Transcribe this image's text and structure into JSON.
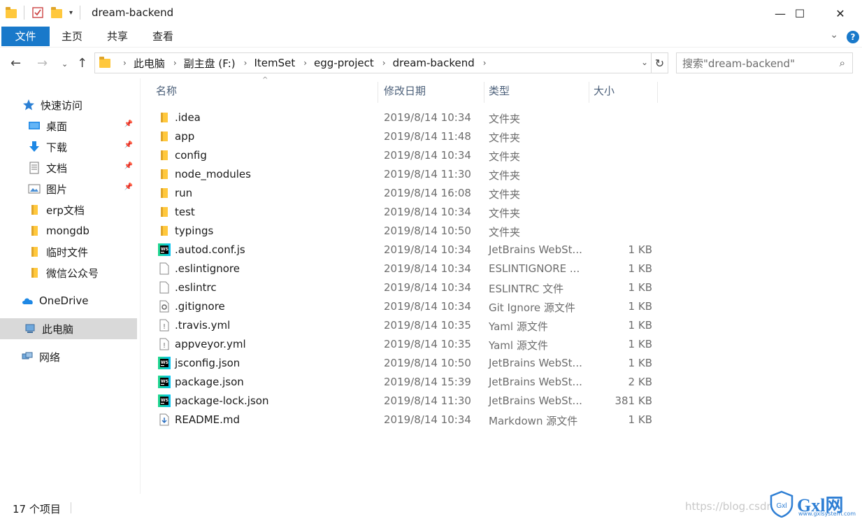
{
  "window": {
    "title": "dream-backend",
    "minimize": "—",
    "maximize": "☐",
    "close": "✕"
  },
  "ribbon": {
    "tabs": [
      "文件",
      "主页",
      "共享",
      "查看"
    ],
    "help": "?"
  },
  "address": {
    "crumbs": [
      "此电脑",
      "副主盘 (F:)",
      "ItemSet",
      "egg-project",
      "dream-backend"
    ],
    "search_placeholder": "搜索\"dream-backend\""
  },
  "sidebar": {
    "items": [
      {
        "label": "快速访问",
        "icon": "star-icon",
        "pinned": false
      },
      {
        "label": "桌面",
        "icon": "desktop-icon",
        "pinned": true
      },
      {
        "label": "下载",
        "icon": "download-icon",
        "pinned": true
      },
      {
        "label": "文档",
        "icon": "document-icon",
        "pinned": true
      },
      {
        "label": "图片",
        "icon": "pictures-icon",
        "pinned": true
      },
      {
        "label": "erp文档",
        "icon": "folder-icon",
        "pinned": false
      },
      {
        "label": "mongdb",
        "icon": "folder-icon",
        "pinned": false
      },
      {
        "label": "临时文件",
        "icon": "folder-icon",
        "pinned": false
      },
      {
        "label": "微信公众号",
        "icon": "folder-icon",
        "pinned": false
      },
      {
        "label": "OneDrive",
        "icon": "cloud-icon",
        "pinned": false
      },
      {
        "label": "此电脑",
        "icon": "computer-icon",
        "pinned": false,
        "selected": true
      },
      {
        "label": "网络",
        "icon": "network-icon",
        "pinned": false
      }
    ]
  },
  "columns": {
    "name": "名称",
    "date": "修改日期",
    "type": "类型",
    "size": "大小"
  },
  "files": [
    {
      "name": ".idea",
      "date": "2019/8/14 10:34",
      "type": "文件夹",
      "size": "",
      "icon": "folder"
    },
    {
      "name": "app",
      "date": "2019/8/14 11:48",
      "type": "文件夹",
      "size": "",
      "icon": "folder"
    },
    {
      "name": "config",
      "date": "2019/8/14 10:34",
      "type": "文件夹",
      "size": "",
      "icon": "folder"
    },
    {
      "name": "node_modules",
      "date": "2019/8/14 11:30",
      "type": "文件夹",
      "size": "",
      "icon": "folder"
    },
    {
      "name": "run",
      "date": "2019/8/14 16:08",
      "type": "文件夹",
      "size": "",
      "icon": "folder"
    },
    {
      "name": "test",
      "date": "2019/8/14 10:34",
      "type": "文件夹",
      "size": "",
      "icon": "folder"
    },
    {
      "name": "typings",
      "date": "2019/8/14 10:50",
      "type": "文件夹",
      "size": "",
      "icon": "folder"
    },
    {
      "name": ".autod.conf.js",
      "date": "2019/8/14 10:34",
      "type": "JetBrains WebSt...",
      "size": "1 KB",
      "icon": "webstorm"
    },
    {
      "name": ".eslintignore",
      "date": "2019/8/14 10:34",
      "type": "ESLINTIGNORE ...",
      "size": "1 KB",
      "icon": "blank"
    },
    {
      "name": ".eslintrc",
      "date": "2019/8/14 10:34",
      "type": "ESLINTRC 文件",
      "size": "1 KB",
      "icon": "blank"
    },
    {
      "name": ".gitignore",
      "date": "2019/8/14 10:34",
      "type": "Git Ignore 源文件",
      "size": "1 KB",
      "icon": "config"
    },
    {
      "name": ".travis.yml",
      "date": "2019/8/14 10:35",
      "type": "Yaml 源文件",
      "size": "1 KB",
      "icon": "yaml"
    },
    {
      "name": "appveyor.yml",
      "date": "2019/8/14 10:35",
      "type": "Yaml 源文件",
      "size": "1 KB",
      "icon": "yaml"
    },
    {
      "name": "jsconfig.json",
      "date": "2019/8/14 10:50",
      "type": "JetBrains WebSt...",
      "size": "1 KB",
      "icon": "webstorm"
    },
    {
      "name": "package.json",
      "date": "2019/8/14 15:39",
      "type": "JetBrains WebSt...",
      "size": "2 KB",
      "icon": "webstorm"
    },
    {
      "name": "package-lock.json",
      "date": "2019/8/14 11:30",
      "type": "JetBrains WebSt...",
      "size": "381 KB",
      "icon": "webstorm"
    },
    {
      "name": "README.md",
      "date": "2019/8/14 10:34",
      "type": "Markdown 源文件",
      "size": "1 KB",
      "icon": "markdown"
    }
  ],
  "status": {
    "count": "17 个项目",
    "watermark": "https://blog.csdn",
    "logo_text": "Gxl网",
    "logo_badge": "Gxl",
    "logo_url": "www.gxlsystem.com"
  },
  "colors": {
    "accent": "#1979ca",
    "folder": "#ffc83d"
  }
}
